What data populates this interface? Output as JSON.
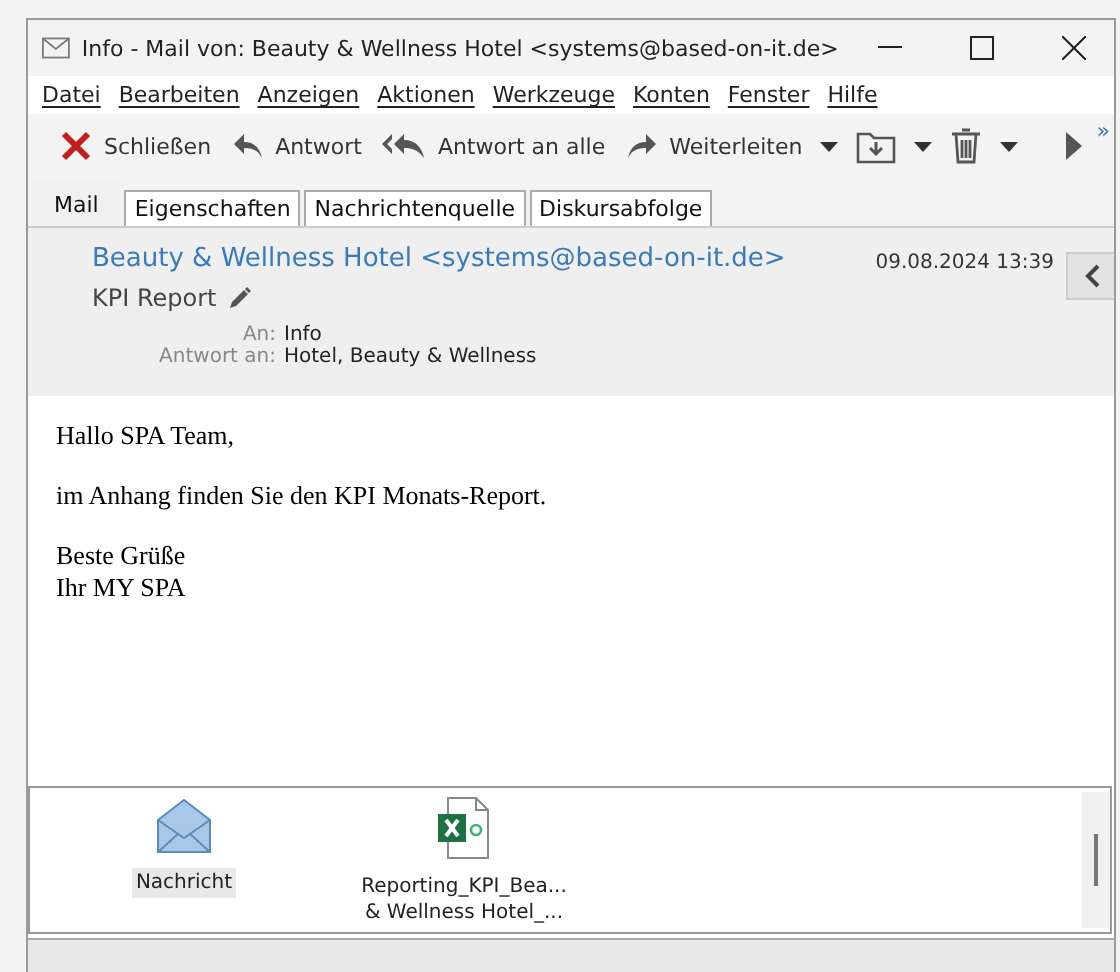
{
  "window": {
    "title": "Info - Mail von: Beauty & Wellness Hotel <systems@based-on-it.de>"
  },
  "menu": [
    "Datei",
    "Bearbeiten",
    "Anzeigen",
    "Aktionen",
    "Werkzeuge",
    "Konten",
    "Fenster",
    "Hilfe"
  ],
  "toolbar": [
    {
      "kind": "close",
      "label": "Schließen"
    },
    {
      "kind": "reply",
      "label": "Antwort"
    },
    {
      "kind": "reply_all",
      "label": "Antwort an alle"
    },
    {
      "kind": "forward",
      "label": "Weiterleiten"
    },
    {
      "kind": "move"
    },
    {
      "kind": "delete"
    },
    {
      "kind": "next"
    }
  ],
  "toolbar_overflow": "»",
  "tabs": [
    {
      "label": "Mail",
      "selected": true
    },
    {
      "label": "Eigenschaften",
      "selected": false
    },
    {
      "label": "Nachrichtenquelle",
      "selected": false
    },
    {
      "label": "Diskursabfolge",
      "selected": false
    }
  ],
  "header": {
    "from": "Beauty & Wellness Hotel <systems@based-on-it.de>",
    "date": "09.08.2024 13:39",
    "subject": "KPI Report",
    "fields": [
      {
        "label": "An:",
        "value": "Info"
      },
      {
        "label": "Antwort an:",
        "value": "Hotel, Beauty & Wellness"
      }
    ]
  },
  "body": [
    "Hallo SPA Team,",
    "im Anhang finden Sie den KPI Monats-Report.",
    "Beste Grüße\nIhr MY SPA"
  ],
  "attachments": [
    {
      "kind": "message",
      "name": "Nachricht",
      "selected": true
    },
    {
      "kind": "excel",
      "name": "Reporting_KPI_Bea...\n& Wellness Hotel_...",
      "selected": false
    }
  ]
}
